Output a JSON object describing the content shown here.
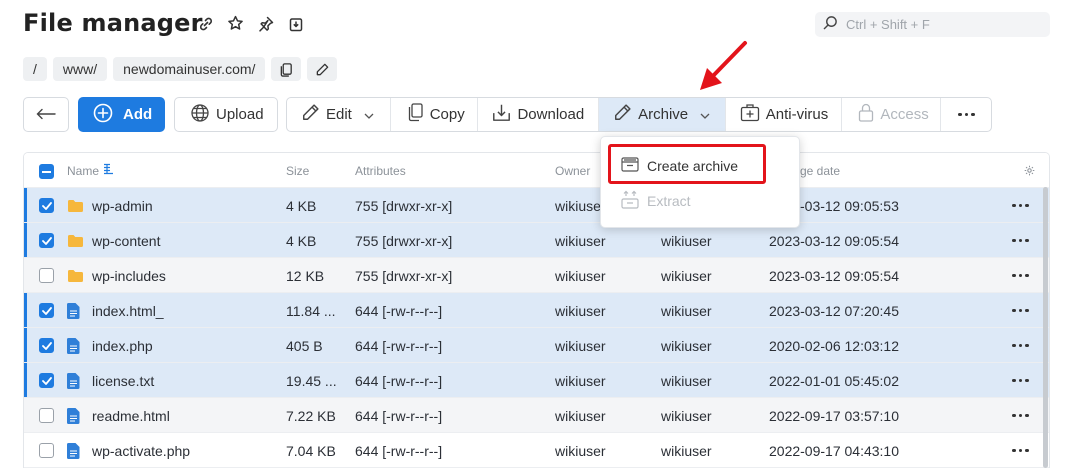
{
  "header": {
    "title": "File manager"
  },
  "search": {
    "placeholder": "Ctrl + Shift + F"
  },
  "breadcrumb": [
    "/",
    "www/",
    "newdomainuser.com/"
  ],
  "toolbar": {
    "add": "Add",
    "upload": "Upload",
    "edit": "Edit",
    "copy": "Copy",
    "download": "Download",
    "archive": "Archive",
    "antivirus": "Anti-virus",
    "access": "Access"
  },
  "columns": {
    "name": "Name",
    "size": "Size",
    "attributes": "Attributes",
    "owner": "Owner",
    "change_date": "ge date"
  },
  "archive_menu": {
    "create": "Create archive",
    "extract": "Extract"
  },
  "rows": [
    {
      "type": "folder",
      "name": "wp-admin",
      "size": "4 KB",
      "attributes": "755 [drwxr-xr-x]",
      "owner": "wikiuser",
      "group": "",
      "date": "-03-12 09:05:53",
      "selected": true
    },
    {
      "type": "folder",
      "name": "wp-content",
      "size": "4 KB",
      "attributes": "755 [drwxr-xr-x]",
      "owner": "wikiuser",
      "group": "wikiuser",
      "date": "2023-03-12 09:05:54",
      "selected": true
    },
    {
      "type": "folder",
      "name": "wp-includes",
      "size": "12 KB",
      "attributes": "755 [drwxr-xr-x]",
      "owner": "wikiuser",
      "group": "wikiuser",
      "date": "2023-03-12 09:05:54",
      "selected": false
    },
    {
      "type": "file",
      "name": "index.html_",
      "size": "11.84 ...",
      "attributes": "644 [-rw-r--r--]",
      "owner": "wikiuser",
      "group": "wikiuser",
      "date": "2023-03-12 07:20:45",
      "selected": true
    },
    {
      "type": "file",
      "name": "index.php",
      "size": "405 B",
      "attributes": "644 [-rw-r--r--]",
      "owner": "wikiuser",
      "group": "wikiuser",
      "date": "2020-02-06 12:03:12",
      "selected": true
    },
    {
      "type": "file",
      "name": "license.txt",
      "size": "19.45 ...",
      "attributes": "644 [-rw-r--r--]",
      "owner": "wikiuser",
      "group": "wikiuser",
      "date": "2022-01-01 05:45:02",
      "selected": true
    },
    {
      "type": "file",
      "name": "readme.html",
      "size": "7.22 KB",
      "attributes": "644 [-rw-r--r--]",
      "owner": "wikiuser",
      "group": "wikiuser",
      "date": "2022-09-17 03:57:10",
      "selected": false
    },
    {
      "type": "file",
      "name": "wp-activate.php",
      "size": "7.04 KB",
      "attributes": "644 [-rw-r--r--]",
      "owner": "wikiuser",
      "group": "wikiuser",
      "date": "2022-09-17 04:43:10",
      "selected": false
    }
  ],
  "colors": {
    "accent": "#1e7be0",
    "selected_row": "#dde9f7",
    "highlight": "#e3141b",
    "folder": "#f6b73c"
  }
}
